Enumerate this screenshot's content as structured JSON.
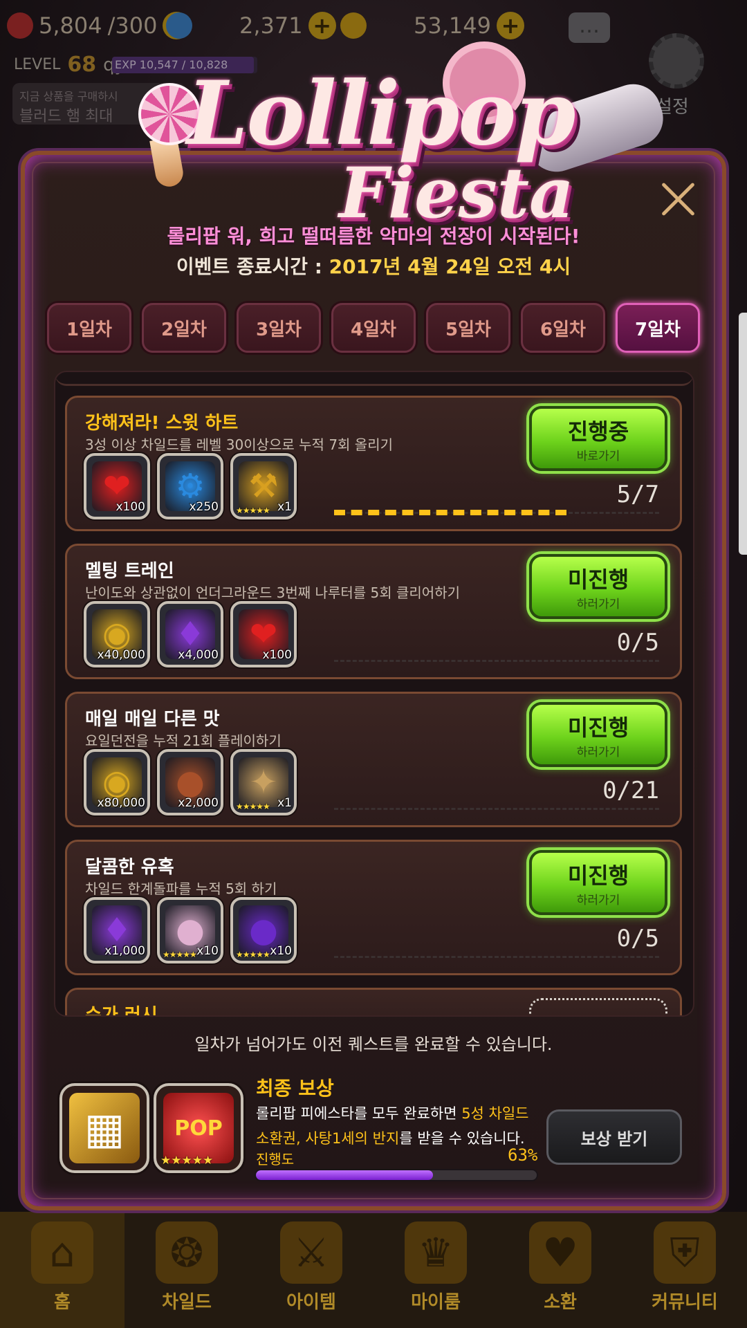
{
  "hud": {
    "hearts": "5,804",
    "hearts_max": "/300",
    "currency2": "2,371",
    "currency3": "53,149",
    "level_label": "LEVEL",
    "level_value": "68",
    "player_name": "qyz",
    "exp_text": "EXP 10,547 / 10,828",
    "exp_fraction": 0.974,
    "side_text1": "지금 상품을 구매하시",
    "side_text2": "블러드 햄 최대",
    "settings_label": "설정"
  },
  "event": {
    "logo_line1": "Lollipop",
    "logo_line2": "Fiesta",
    "subtitle": "롤리팝 워, 희고 떨떠름한 악마의 전장이 시작된다!",
    "end_label": "이벤트 종료시간 : ",
    "end_value": "2017년 4월 24일 오전 4시"
  },
  "tabs": [
    {
      "label": "1일차",
      "active": false
    },
    {
      "label": "2일차",
      "active": false
    },
    {
      "label": "3일차",
      "active": false
    },
    {
      "label": "4일차",
      "active": false
    },
    {
      "label": "5일차",
      "active": false
    },
    {
      "label": "6일차",
      "active": false
    },
    {
      "label": "7일차",
      "active": true
    }
  ],
  "quests": [
    {
      "title": "강해져라! 스윗 하트",
      "desc": "3성 이상 차일드를 레벨 30이상으로 누적 7회 올리기",
      "button_main": "진행중",
      "button_sub": "바로가기",
      "progress": "5/7",
      "progress_fraction": 0.714,
      "rewards": [
        {
          "icon": "heart-icon",
          "glyph": "❤",
          "qty": "x100",
          "color": "#e02020"
        },
        {
          "icon": "gear-token-icon",
          "glyph": "⚙",
          "qty": "x250",
          "color": "#2a8adf"
        },
        {
          "icon": "treasure-chest-icon",
          "glyph": "⚒",
          "qty": "x1",
          "color": "#d8a020",
          "stars": "★★★★★"
        }
      ]
    },
    {
      "title": "멜팅 트레인",
      "desc": "난이도와 상관없이 언더그라운드 3번째 나루터를 5회 클리어하기",
      "button_main": "미진행",
      "button_sub": "하러가기",
      "progress": "0/5",
      "progress_fraction": 0,
      "rewards": [
        {
          "icon": "gold-coins-icon",
          "glyph": "◉",
          "qty": "x40,000",
          "color": "#d8a820"
        },
        {
          "icon": "purple-gem-icon",
          "glyph": "♦",
          "qty": "x4,000",
          "color": "#8a3ad8"
        },
        {
          "icon": "heart-icon",
          "glyph": "❤",
          "qty": "x100",
          "color": "#e02020"
        }
      ]
    },
    {
      "title": "매일 매일 다른 맛",
      "desc": "요일던전을 누적 21회 플레이하기",
      "button_main": "미진행",
      "button_sub": "하러가기",
      "progress": "0/21",
      "progress_fraction": 0,
      "rewards": [
        {
          "icon": "gold-coins-icon",
          "glyph": "◉",
          "qty": "x80,000",
          "color": "#d8a820"
        },
        {
          "icon": "bronze-medal-icon",
          "glyph": "●",
          "qty": "x2,000",
          "color": "#a8502a"
        },
        {
          "icon": "plus-one-orb-icon",
          "glyph": "✦",
          "qty": "x1",
          "color": "#c8a060",
          "stars": "★★★★★"
        }
      ]
    },
    {
      "title": "달콤한 유혹",
      "desc": "차일드 한계돌파를 누적 5회 하기",
      "button_main": "미진행",
      "button_sub": "하러가기",
      "progress": "0/5",
      "progress_fraction": 0,
      "rewards": [
        {
          "icon": "purple-gem-icon",
          "glyph": "♦",
          "qty": "x1,000",
          "color": "#8a3ad8"
        },
        {
          "icon": "pink-orb-icon",
          "glyph": "●",
          "qty": "x10",
          "color": "#e0b0d0",
          "stars": "★★★★★"
        },
        {
          "icon": "violet-orb-icon",
          "glyph": "●",
          "qty": "x10",
          "color": "#6a2ac8",
          "stars": "★★★★★"
        }
      ]
    }
  ],
  "partial_quest": {
    "title": "슈가 러시"
  },
  "note": "일차가 넘어가도 이전 퀘스트를 완료할 수 있습니다.",
  "final": {
    "title": "최종 보상",
    "desc_pre": "롤리팝 피에스타를 모두 완료하면 ",
    "desc_hl1": "5성 차일드",
    "desc_hl2": "소환권, 사탕1세의 반지",
    "desc_post": "를 받을 수 있습니다.",
    "progress_label": "진행도",
    "progress_pct": "63%",
    "progress_fraction": 0.63,
    "claim_label": "보상 받기",
    "reward_stars": "★★★★★",
    "reward2_text": "POP"
  },
  "nav": [
    {
      "label": "홈",
      "icon": "home-gate-icon",
      "glyph": "⌂"
    },
    {
      "label": "차일드",
      "icon": "flame-eye-icon",
      "glyph": "❂"
    },
    {
      "label": "아이템",
      "icon": "sword-shield-icon",
      "glyph": "⚔"
    },
    {
      "label": "마이룸",
      "icon": "crown-laurel-icon",
      "glyph": "♛"
    },
    {
      "label": "소환",
      "icon": "heart-bottle-icon",
      "glyph": "♥"
    },
    {
      "label": "커뮤니티",
      "icon": "shield-crest-icon",
      "glyph": "⛨"
    }
  ]
}
